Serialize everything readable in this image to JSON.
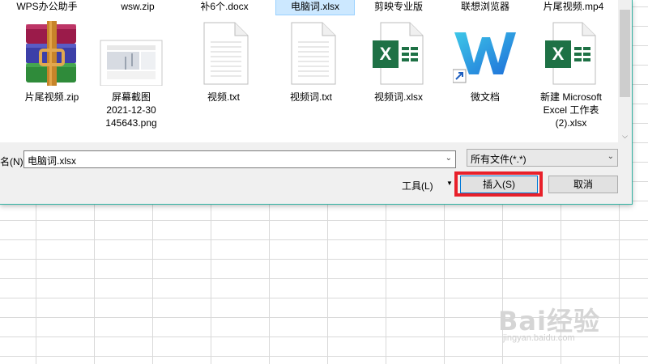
{
  "top_row": [
    "WPS办公助手",
    "wsw.zip",
    "补6个.docx",
    "电脑词.xlsx",
    "剪映专业版",
    "联想浏览器",
    "片尾视频.mp4"
  ],
  "files": [
    {
      "name": "片尾视频.zip",
      "icon": "winrar-archive-icon"
    },
    {
      "name": "屏幕截图\n2021-12-30\n145643.png",
      "icon": "image-thumbnail-icon"
    },
    {
      "name": "视频.txt",
      "icon": "text-file-icon"
    },
    {
      "name": "视频词.txt",
      "icon": "text-file-icon"
    },
    {
      "name": "视频词.xlsx",
      "icon": "excel-file-icon"
    },
    {
      "name": "微文档",
      "icon": "wps-w-shortcut-icon"
    },
    {
      "name": "新建 Microsoft\nExcel 工作表\n(2).xlsx",
      "icon": "excel-file-icon"
    }
  ],
  "filename_label": "名(N):",
  "filename_value": "电脑词.xlsx",
  "filetype_value": "所有文件(*.*)",
  "tools_label": "工具(L)",
  "insert_label": "插入(S)",
  "cancel_label": "取消",
  "watermark": {
    "text": "Bai经验",
    "url": "jingyan.baidu.com"
  },
  "colors": {
    "accent_border": "#2fb3a2",
    "highlight": "#e8202a",
    "selection": "#cce8ff",
    "excel_green": "#1e7145"
  }
}
